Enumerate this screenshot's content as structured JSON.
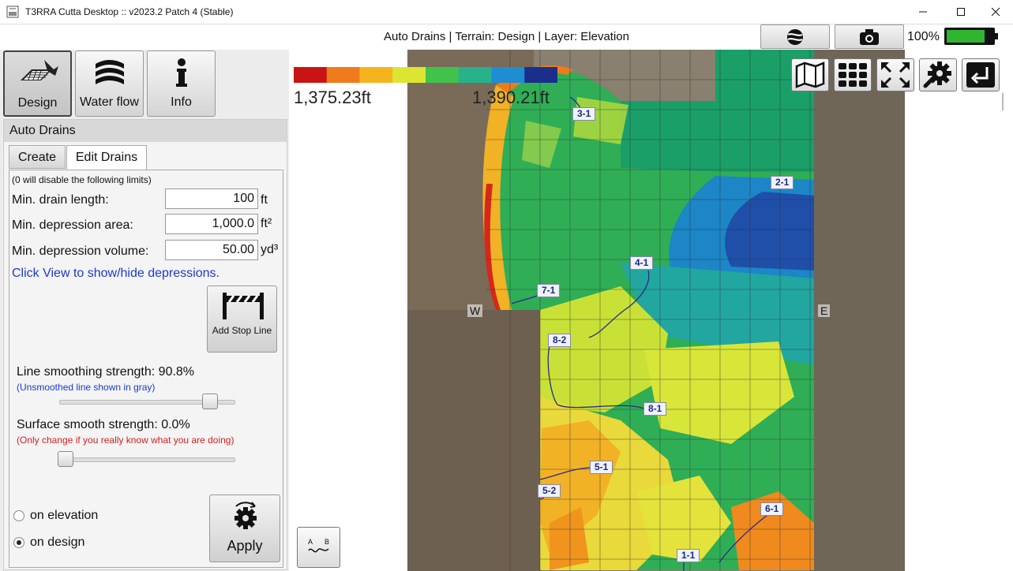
{
  "window": {
    "title": "T3RRA Cutta Desktop :: v2023.2 Patch 4 (Stable)"
  },
  "header": {
    "title": "Auto Drains | Terrain: Design | Layer: Elevation",
    "zoom_percent": "100%",
    "battery_level": 0.85
  },
  "modes": [
    {
      "label": "Design",
      "icon": "tractor-tablet-icon",
      "active": true
    },
    {
      "label": "Water flow",
      "icon": "water-waves-icon",
      "active": false
    },
    {
      "label": "Info",
      "icon": "info-icon",
      "active": false
    }
  ],
  "panel": {
    "title": "Auto Drains",
    "tabs": [
      {
        "label": "Create",
        "active": false
      },
      {
        "label": "Edit Drains",
        "active": true
      }
    ],
    "limits_note": "(0 will disable the following limits)",
    "fields": [
      {
        "label": "Min. drain length:",
        "value": "100",
        "unit": "ft"
      },
      {
        "label": "Min. depression area:",
        "value": "1,000.0",
        "unit": "ft²"
      },
      {
        "label": "Min. depression volume:",
        "value": "50.00",
        "unit": "yd³"
      }
    ],
    "view_link": "Click View to show/hide depressions.",
    "stop_line_button": "Add Stop Line",
    "line_smoothing": {
      "label": "Line smoothing strength: 90.8%",
      "note": "(Unsmoothed line shown in gray)",
      "value": 0.908
    },
    "surface_smoothing": {
      "label": "Surface smooth strength: 0.0%",
      "note": "(Only change if you really know what you are doing)",
      "value": 0.0
    },
    "radios": [
      {
        "label": "on elevation",
        "checked": false
      },
      {
        "label": "on design",
        "checked": true
      }
    ],
    "apply_button": "Apply"
  },
  "legend": {
    "min": "1,375.23ft",
    "max": "1,390.21ft",
    "colors": [
      "#c81414",
      "#f07b1c",
      "#f5b41e",
      "#dce632",
      "#41c24b",
      "#27b28c",
      "#1e8ed2",
      "#1a2f8c"
    ]
  },
  "map": {
    "drain_labels": [
      "3-1",
      "2-1",
      "4-1",
      "7-1",
      "8-2",
      "8-1",
      "5-1",
      "5-2",
      "6-1",
      "1-1"
    ],
    "compass": {
      "west": "W",
      "east": "E"
    },
    "toolbar_icons": [
      "map-icon",
      "grid-icon",
      "fullscreen-icon",
      "settings-icon",
      "exit-icon"
    ],
    "profile_button_icon": "profile-ab-icon"
  },
  "colors": {
    "highlight_text": "#1a3ad0",
    "warning_text": "#d42020"
  }
}
